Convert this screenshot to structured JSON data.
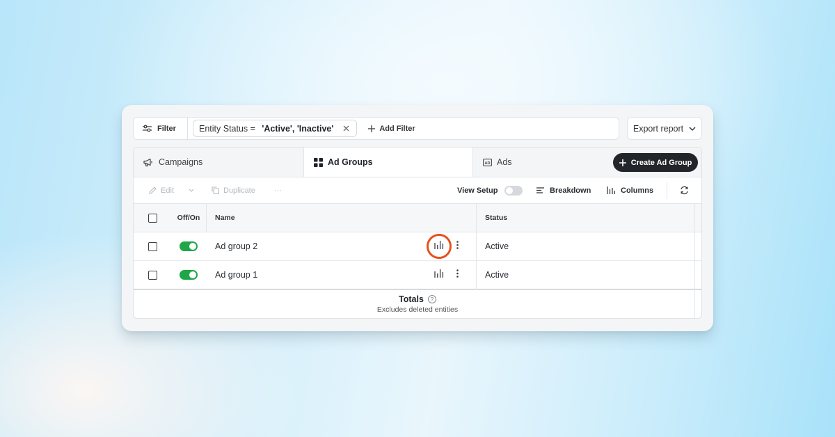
{
  "filter_bar": {
    "filter_label": "Filter",
    "chip": {
      "prefix": "Entity Status = ",
      "value": "'Active', 'Inactive'"
    },
    "add_filter_label": "Add Filter"
  },
  "export": {
    "label": "Export report"
  },
  "tabs": [
    {
      "label": "Campaigns",
      "icon": "megaphone-icon",
      "active": false
    },
    {
      "label": "Ad Groups",
      "icon": "grid-icon",
      "active": true
    },
    {
      "label": "Ads",
      "icon": "ad-icon",
      "active": false
    }
  ],
  "create_button": {
    "label": "Create Ad Group"
  },
  "toolbar": {
    "edit_label": "Edit",
    "duplicate_label": "Duplicate",
    "more_label": "···",
    "view_setup_label": "View Setup",
    "breakdown_label": "Breakdown",
    "columns_label": "Columns"
  },
  "table": {
    "headers": {
      "offon": "Off/On",
      "name": "Name",
      "status": "Status"
    },
    "rows": [
      {
        "name": "Ad group 2",
        "status": "Active",
        "enabled": true,
        "highlighted": true
      },
      {
        "name": "Ad group 1",
        "status": "Active",
        "enabled": true,
        "highlighted": false
      }
    ],
    "totals": {
      "title": "Totals",
      "note": "Excludes deleted entities"
    }
  },
  "colors": {
    "toggle_on": "#1ea647",
    "highlight_ring": "#e8501c",
    "dark_button": "#22262b"
  }
}
